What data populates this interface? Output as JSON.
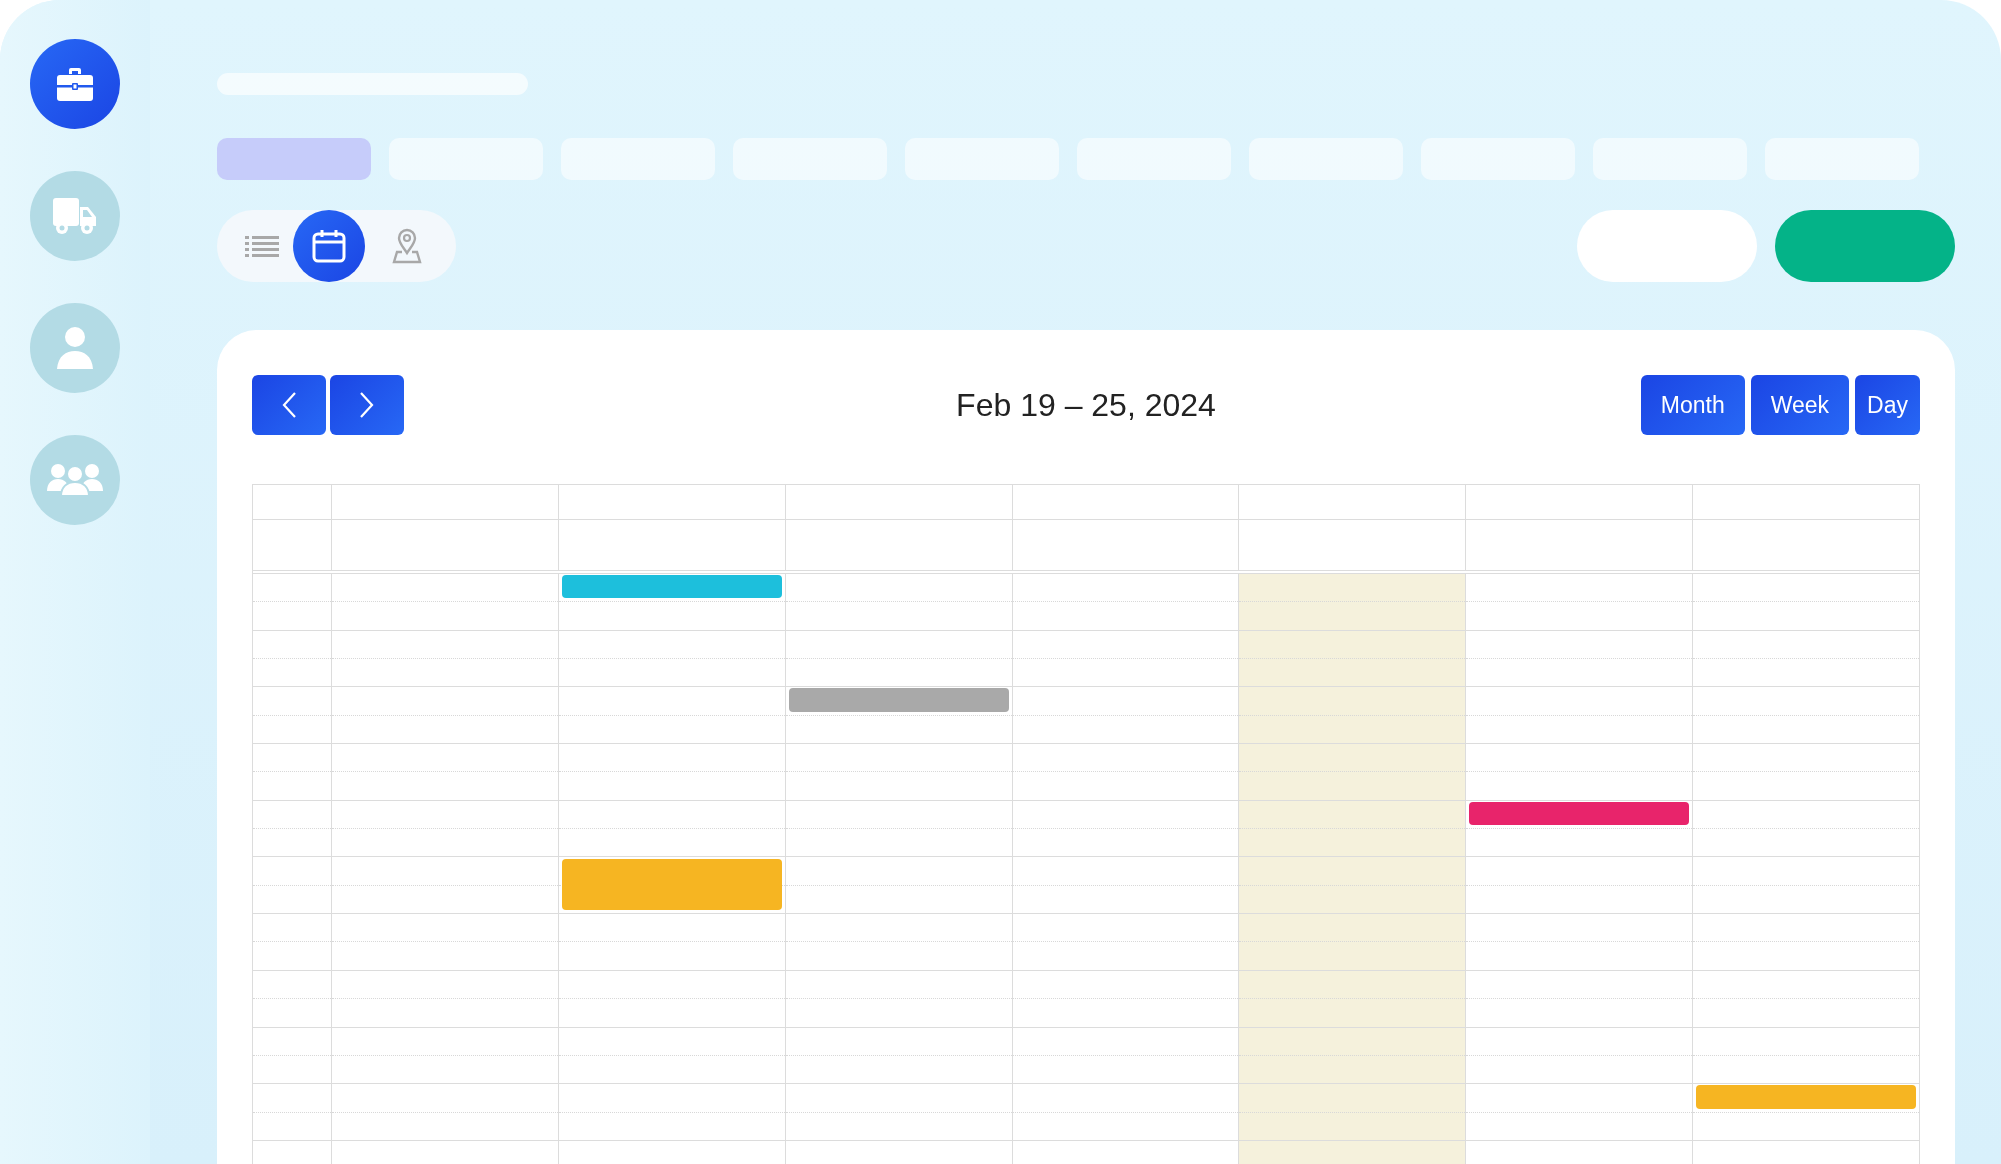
{
  "sidebar": {
    "items": [
      {
        "kind": "briefcase",
        "selected": true
      },
      {
        "kind": "truck",
        "selected": false
      },
      {
        "kind": "person",
        "selected": false
      },
      {
        "kind": "group",
        "selected": false
      }
    ]
  },
  "tabs": [
    {
      "selected": true
    },
    {
      "selected": false
    },
    {
      "selected": false
    },
    {
      "selected": false
    },
    {
      "selected": false
    },
    {
      "selected": false
    },
    {
      "selected": false
    },
    {
      "selected": false
    },
    {
      "selected": false
    },
    {
      "selected": false
    }
  ],
  "view_modes": [
    {
      "kind": "list",
      "selected": false
    },
    {
      "kind": "calendar",
      "selected": true
    },
    {
      "kind": "map",
      "selected": false
    }
  ],
  "actions": [
    {
      "kind": "secondary"
    },
    {
      "kind": "primary"
    }
  ],
  "calendar": {
    "title": "Feb 19 – 25, 2024",
    "ranges": [
      {
        "label": "Month"
      },
      {
        "label": "Week"
      },
      {
        "label": "Day"
      }
    ],
    "days": [
      {
        "today": false
      },
      {
        "today": false
      },
      {
        "today": false
      },
      {
        "today": false
      },
      {
        "today": true
      },
      {
        "today": false
      },
      {
        "today": false
      }
    ],
    "events": [
      {
        "color": "#1dbfdc"
      },
      {
        "color": "#a9a9a9"
      },
      {
        "color": "#e8246b"
      },
      {
        "color": "#f6b522"
      },
      {
        "color": "#f6b522"
      }
    ]
  }
}
